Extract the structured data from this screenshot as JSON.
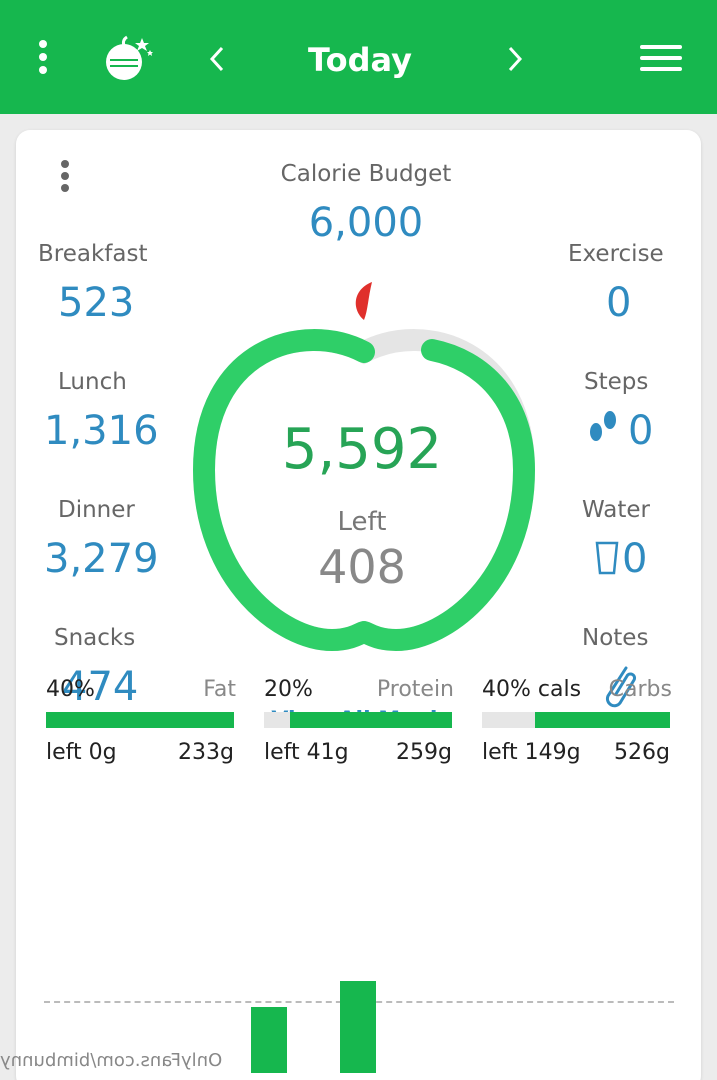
{
  "header": {
    "title": "Today",
    "menu_icon": "kebab-icon",
    "logo_icon": "apple-logo-icon",
    "prev_icon": "chevron-left-icon",
    "next_icon": "chevron-right-icon",
    "hamburger_icon": "hamburger-icon"
  },
  "budget": {
    "label": "Calorie Budget",
    "value": "6,000"
  },
  "meals": {
    "breakfast": {
      "label": "Breakfast",
      "value": "523"
    },
    "lunch": {
      "label": "Lunch",
      "value": "1,316"
    },
    "dinner": {
      "label": "Dinner",
      "value": "3,279"
    },
    "snacks": {
      "label": "Snacks",
      "value": "474"
    }
  },
  "activity": {
    "exercise": {
      "label": "Exercise",
      "value": "0"
    },
    "steps": {
      "label": "Steps",
      "value": "0"
    },
    "water": {
      "label": "Water",
      "value": "0"
    },
    "notes": {
      "label": "Notes"
    }
  },
  "apple": {
    "eaten": "5,592",
    "left_label": "Left",
    "left_value": "408",
    "progress": 0.93
  },
  "view_all": "View All Meals",
  "macros": [
    {
      "name": "Carbs",
      "pct": "40% cals",
      "grams": "526g",
      "left": "left 149g",
      "fill": 0.72
    },
    {
      "name": "Protein",
      "pct": "20%",
      "grams": "259g",
      "left": "left 41g",
      "fill": 0.86
    },
    {
      "name": "Fat",
      "pct": "40%",
      "grams": "233g",
      "left": "left 0g",
      "fill": 1.0
    }
  ],
  "colors": {
    "brand_green": "#16b74e",
    "value_blue": "#2f8bc0",
    "apple_green": "#27a456"
  },
  "watermark": "OnlyFans.com/bimbunny"
}
